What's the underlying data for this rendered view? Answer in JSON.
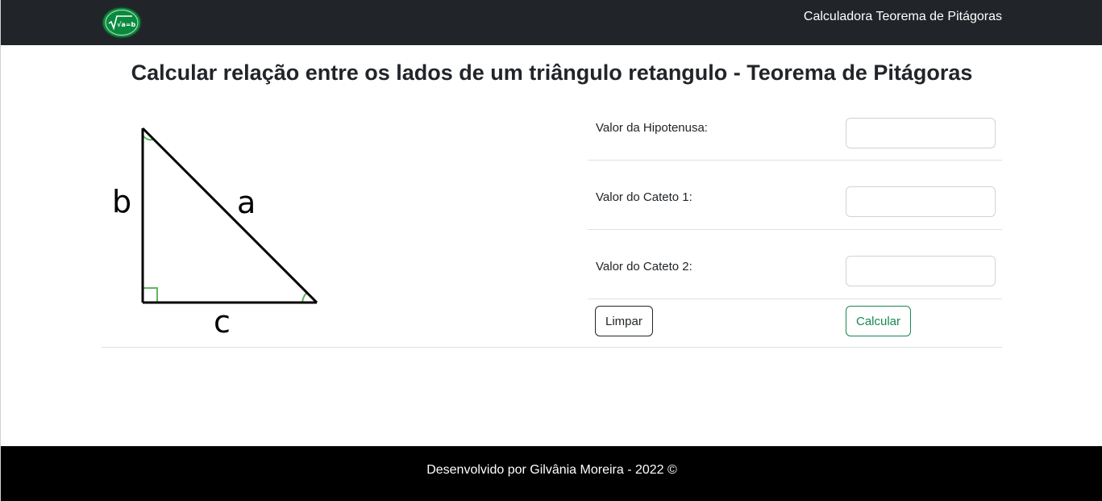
{
  "navbar": {
    "brand_title": "Calculadora Teorema de Pitágoras",
    "logo_text": "√a=b"
  },
  "main": {
    "heading": "Calcular relação entre os lados de um triângulo retangulo - Teorema de Pitágoras",
    "triangle": {
      "side_a": "a",
      "side_b": "b",
      "side_c": "c"
    },
    "form": {
      "fields": [
        {
          "label": "Valor da Hipotenusa:",
          "value": ""
        },
        {
          "label": "Valor do Cateto 1:",
          "value": ""
        },
        {
          "label": "Valor do Cateto 2:",
          "value": ""
        }
      ],
      "clear_button": "Limpar",
      "calculate_button": "Calcular"
    }
  },
  "footer": {
    "text": "Desenvolvido por Gilvânia Moreira - 2022 ©"
  },
  "colors": {
    "navbar_bg": "#212529",
    "footer_bg": "#000000",
    "accent_green": "#198754",
    "logo_green": "#0a8a3e"
  }
}
